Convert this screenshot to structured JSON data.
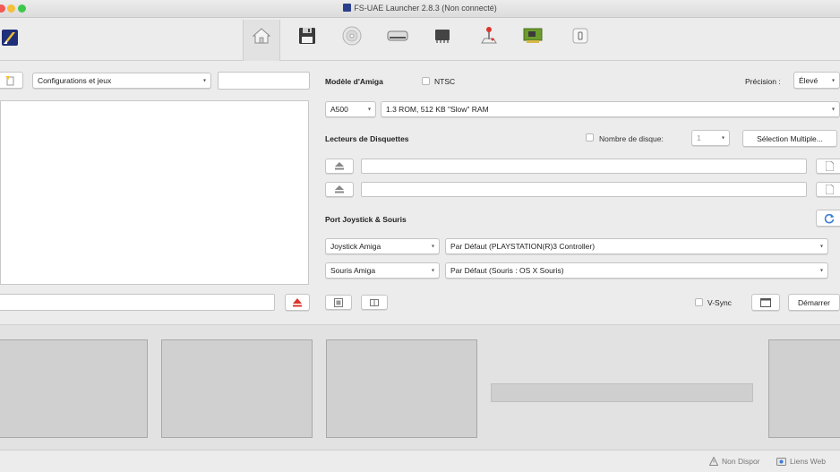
{
  "window": {
    "title": "FS-UAE Launcher 2.8.3 (Non connecté)"
  },
  "toolbar": {
    "tabs": [
      {
        "name": "home-icon"
      },
      {
        "name": "floppy-icon"
      },
      {
        "name": "cdrom-icon"
      },
      {
        "name": "harddrive-icon"
      },
      {
        "name": "rom-chip-icon"
      },
      {
        "name": "joystick-icon"
      },
      {
        "name": "expansion-card-icon"
      },
      {
        "name": "device-icon"
      }
    ]
  },
  "left_panel": {
    "filter_select": "Configurations et jeux",
    "search_value": "",
    "bottom_input_value": ""
  },
  "amiga": {
    "model_label": "Modèle d'Amiga",
    "ntsc_label": "NTSC",
    "ntsc_checked": false,
    "precision_label": "Précision :",
    "precision_value": "Élevé",
    "model_value": "A500",
    "model_detail": "1.3 ROM, 512 KB \"Slow\" RAM"
  },
  "floppy": {
    "section_label": "Lecteurs de Disquettes",
    "count_label": "Nombre de disque:",
    "count_checked": false,
    "count_value": "1",
    "multi_select_button": "Sélection Multiple...",
    "drives": [
      {
        "value": ""
      },
      {
        "value": ""
      }
    ]
  },
  "ports": {
    "section_label": "Port Joystick & Souris",
    "rows": [
      {
        "port": "Joystick Amiga",
        "device": "Par Défaut (PLAYSTATION(R)3 Controller)"
      },
      {
        "port": "Souris Amiga",
        "device": "Par Défaut (Souris : OS X Souris)"
      }
    ]
  },
  "actions": {
    "vsync_label": "V-Sync",
    "vsync_checked": false,
    "start_button": "Démarrer"
  },
  "status": {
    "item1": "Non Dispor",
    "item2": "Liens Web"
  },
  "colors": {
    "accent": "#3b7dd8",
    "window_bg": "#ececec",
    "eject_red": "#d9362c"
  }
}
